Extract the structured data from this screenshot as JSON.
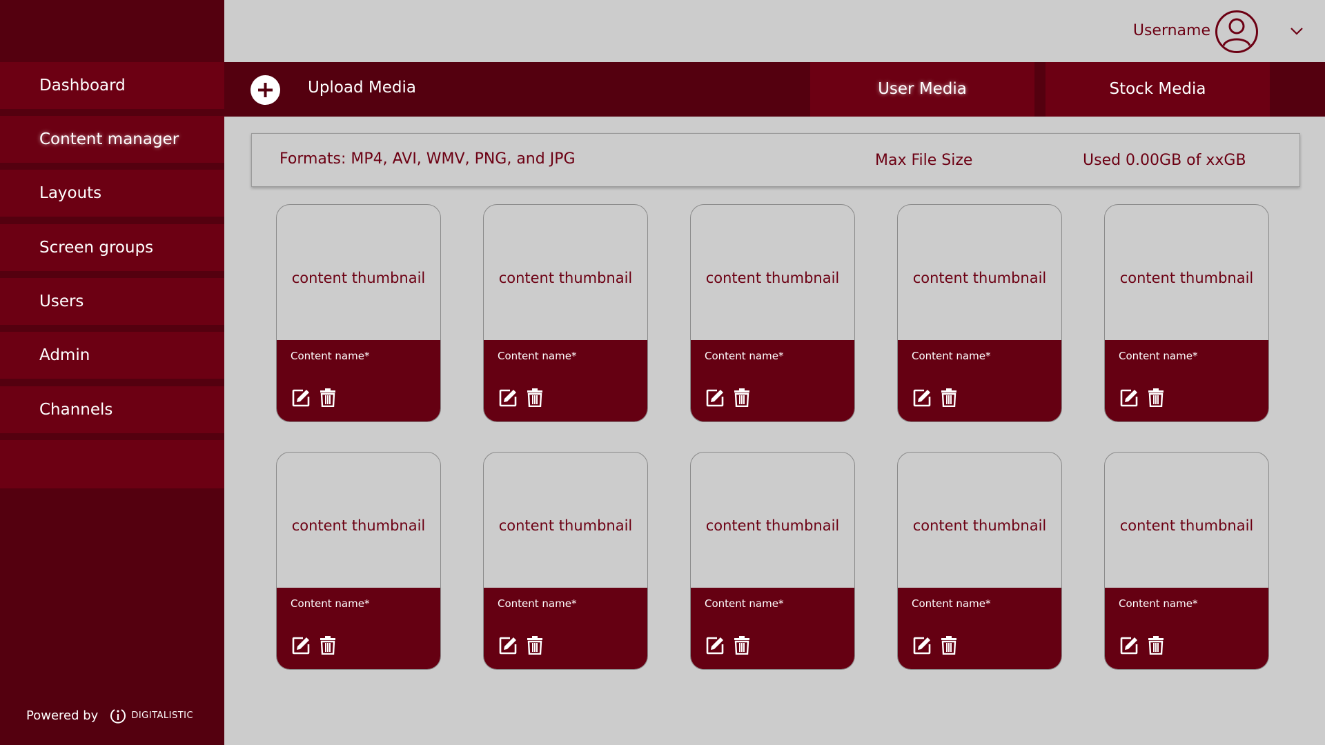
{
  "sidebar": {
    "items": [
      {
        "label": "Dashboard"
      },
      {
        "label": "Content manager",
        "active": true
      },
      {
        "label": "Layouts"
      },
      {
        "label": "Screen groups"
      },
      {
        "label": "Users"
      },
      {
        "label": "Admin"
      },
      {
        "label": "Channels"
      }
    ],
    "powered_by": "Powered by",
    "brand": "DIGITALISTIC"
  },
  "header": {
    "username": "Username",
    "avatar_icon": "user-circle-icon",
    "menu_icon": "chevron-down-icon"
  },
  "tabbar": {
    "upload_label": "Upload Media",
    "upload_icon": "plus-circle-icon",
    "tabs": [
      {
        "label": "User Media",
        "active": true
      },
      {
        "label": "Stock Media"
      }
    ]
  },
  "info": {
    "formats": "Formats: MP4, AVI, WMV, PNG, and JPG",
    "max_size": "Max File Size",
    "usage": "Used 0.00GB of xxGB"
  },
  "cards": [
    {
      "thumbnail": "content thumbnail",
      "name": "Content name*"
    },
    {
      "thumbnail": "content thumbnail",
      "name": "Content name*"
    },
    {
      "thumbnail": "content thumbnail",
      "name": "Content name*"
    },
    {
      "thumbnail": "content thumbnail",
      "name": "Content name*"
    },
    {
      "thumbnail": "content thumbnail",
      "name": "Content name*"
    },
    {
      "thumbnail": "content thumbnail",
      "name": "Content name*"
    },
    {
      "thumbnail": "content thumbnail",
      "name": "Content name*"
    },
    {
      "thumbnail": "content thumbnail",
      "name": "Content name*"
    },
    {
      "thumbnail": "content thumbnail",
      "name": "Content name*"
    },
    {
      "thumbnail": "content thumbnail",
      "name": "Content name*"
    }
  ],
  "card_icons": {
    "edit": "edit-icon",
    "delete": "trash-icon"
  },
  "colors": {
    "sidebar_bg": "#54000f",
    "nav_item_bg": "#6c0013",
    "card_footer_bg": "#650012",
    "page_bg": "#cccccc",
    "text_accent": "#6c0013"
  }
}
